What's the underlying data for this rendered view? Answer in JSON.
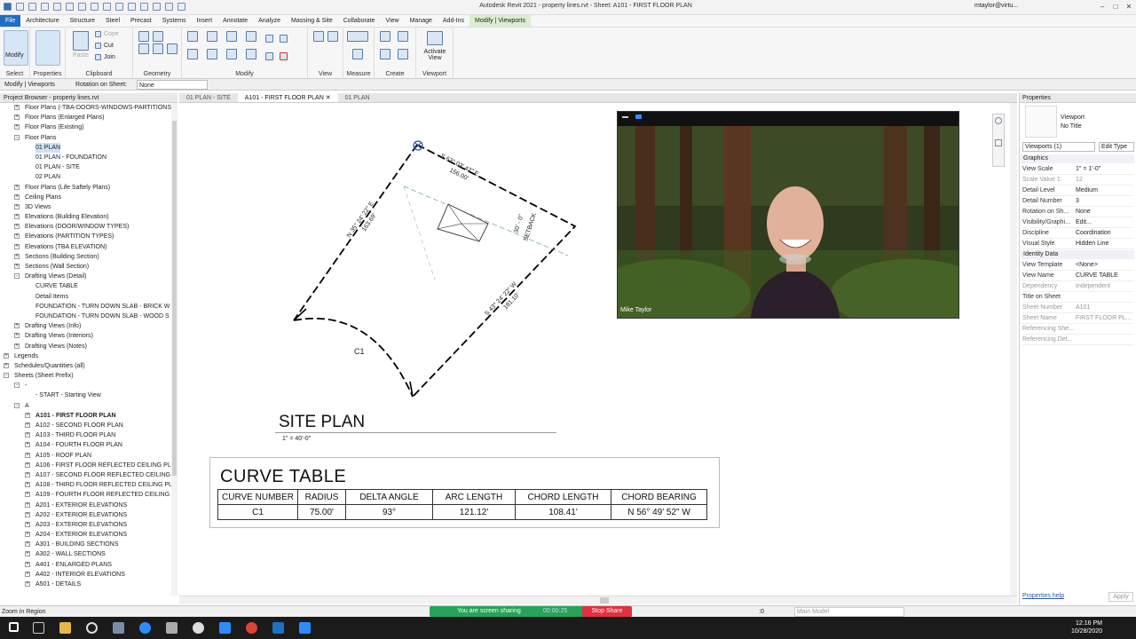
{
  "app": {
    "title": "Autodesk Revit 2021 - property lines.rvt - Sheet: A101 - FIRST FLOOR PLAN",
    "user": "mtaylor@virtu...",
    "menu_tabs": [
      "File",
      "Architecture",
      "Structure",
      "Steel",
      "Precast",
      "Systems",
      "Insert",
      "Annotate",
      "Analyze",
      "Massing & Site",
      "Collaborate",
      "View",
      "Manage",
      "Add-Ins",
      "Modify | Viewports"
    ]
  },
  "ribbon": {
    "groups": [
      "Select",
      "Properties",
      "Clipboard",
      "Geometry",
      "Modify",
      "View",
      "Measure",
      "Create",
      "Viewport"
    ],
    "modify_label": "Modify",
    "clipboard_items": [
      "Paste",
      "Cope",
      "Cut",
      "Join"
    ],
    "activate_view": "Activate View"
  },
  "options_bar": {
    "context": "Modify | Viewports",
    "rotation_label": "Rotation on Sheet:",
    "rotation_value": "None"
  },
  "project_browser": {
    "header": "Project Browser - property lines.rvt",
    "items": [
      {
        "label": "Floor Plans (-TBA-DOORS-WINDOWS-PARTITIONS",
        "level": 1,
        "tw": "+"
      },
      {
        "label": "Floor Plans (Enlarged Plans)",
        "level": 1,
        "tw": "+"
      },
      {
        "label": "Floor Plans (Existing)",
        "level": 1,
        "tw": "+"
      },
      {
        "label": "Floor Plans",
        "level": 1,
        "tw": "-"
      },
      {
        "label": "01 PLAN",
        "level": 2,
        "tw": "",
        "sel": true
      },
      {
        "label": "01 PLAN - FOUNDATION",
        "level": 2,
        "tw": ""
      },
      {
        "label": "01 PLAN - SITE",
        "level": 2,
        "tw": ""
      },
      {
        "label": "02 PLAN",
        "level": 2,
        "tw": ""
      },
      {
        "label": "Floor Plans (Life Saftely Plans)",
        "level": 1,
        "tw": "+"
      },
      {
        "label": "Ceiling Plans",
        "level": 1,
        "tw": "+"
      },
      {
        "label": "3D Views",
        "level": 1,
        "tw": "+"
      },
      {
        "label": "Elevations (Building Elevation)",
        "level": 1,
        "tw": "+"
      },
      {
        "label": "Elevations (DOOR/WINDOW TYPES)",
        "level": 1,
        "tw": "+"
      },
      {
        "label": "Elevations (PARTITION TYPES)",
        "level": 1,
        "tw": "+"
      },
      {
        "label": "Elevations (TBA ELEVATION)",
        "level": 1,
        "tw": "+"
      },
      {
        "label": "Sections (Building Section)",
        "level": 1,
        "tw": "+"
      },
      {
        "label": "Sections (Wall Section)",
        "level": 1,
        "tw": "+"
      },
      {
        "label": "Drafting Views (Detail)",
        "level": 1,
        "tw": "-"
      },
      {
        "label": "CURVE TABLE",
        "level": 2,
        "tw": ""
      },
      {
        "label": "Detail Items",
        "level": 2,
        "tw": ""
      },
      {
        "label": "FOUNDATION - TURN DOWN SLAB - BRICK W",
        "level": 2,
        "tw": ""
      },
      {
        "label": "FOUNDATION - TURN DOWN SLAB - WOOD S",
        "level": 2,
        "tw": ""
      },
      {
        "label": "Drafting Views (Info)",
        "level": 1,
        "tw": "+"
      },
      {
        "label": "Drafting Views (Interiors)",
        "level": 1,
        "tw": "+"
      },
      {
        "label": "Drafting Views (Notes)",
        "level": 1,
        "tw": "+"
      },
      {
        "label": "Legends",
        "level": 0,
        "tw": "+"
      },
      {
        "label": "Schedules/Quantities (all)",
        "level": 0,
        "tw": "+"
      },
      {
        "label": "Sheets (Sheet Prefix)",
        "level": 0,
        "tw": "-"
      },
      {
        "label": "-",
        "level": 1,
        "tw": "-"
      },
      {
        "label": "- START - Starting View",
        "level": 2,
        "tw": ""
      },
      {
        "label": "A",
        "level": 1,
        "tw": "-"
      },
      {
        "label": "A101 - FIRST FLOOR PLAN",
        "level": 2,
        "tw": "+",
        "bold": true
      },
      {
        "label": "A102 - SECOND FLOOR PLAN",
        "level": 2,
        "tw": "+"
      },
      {
        "label": "A103 - THIRD FLOOR PLAN",
        "level": 2,
        "tw": "+"
      },
      {
        "label": "A104 - FOURTH FLOOR PLAN",
        "level": 2,
        "tw": "+"
      },
      {
        "label": "A105 - ROOF PLAN",
        "level": 2,
        "tw": "+"
      },
      {
        "label": "A106 - FIRST FLOOR REFLECTED CEILING PLAN",
        "level": 2,
        "tw": "+"
      },
      {
        "label": "A107 - SECOND FLOOR REFLECTED CEILING PL",
        "level": 2,
        "tw": "+"
      },
      {
        "label": "A108 - THIRD FLOOR REFLECTED CEILING PLA",
        "level": 2,
        "tw": "+"
      },
      {
        "label": "A109 - FOURTH FLOOR REFLECTED CEILING PL",
        "level": 2,
        "tw": "+"
      },
      {
        "label": "A201 - EXTERIOR ELEVATIONS",
        "level": 2,
        "tw": "+"
      },
      {
        "label": "A202 - EXTERIOR ELEVATIONS",
        "level": 2,
        "tw": "+"
      },
      {
        "label": "A203 - EXTERIOR ELEVATIONS",
        "level": 2,
        "tw": "+"
      },
      {
        "label": "A204 - EXTERIOR ELEVATIONS",
        "level": 2,
        "tw": "+"
      },
      {
        "label": "A301 - BUILDING SECTIONS",
        "level": 2,
        "tw": "+"
      },
      {
        "label": "A302 - WALL SECTIONS",
        "level": 2,
        "tw": "+"
      },
      {
        "label": "A401 - ENLARGED PLANS",
        "level": 2,
        "tw": "+"
      },
      {
        "label": "A402 - INTERIOR ELEVATIONS",
        "level": 2,
        "tw": "+"
      },
      {
        "label": "A501 - DETAILS",
        "level": 2,
        "tw": "+"
      }
    ]
  },
  "view_tabs": [
    {
      "label": "01 PLAN - SITE",
      "active": false
    },
    {
      "label": "A101 - FIRST FLOOR PLAN",
      "active": true
    },
    {
      "label": "01 PLAN",
      "active": false
    }
  ],
  "drawing": {
    "bearing_top": "S 63° 03' 42\" E",
    "dist_top": "156.00'",
    "bearing_left": "N 35° 24' 22\" E",
    "dist_left": "163.69'",
    "bearing_right": "S 43° 24' 22\" W",
    "dist_right": "181.10'",
    "setback_dist": "30' - 0\"",
    "setback_label": "SETBACK",
    "curve_label": "C1",
    "site_title": "SITE PLAN",
    "site_scale": "1\" = 40'-0\""
  },
  "curve_table": {
    "title": "CURVE TABLE",
    "headers": [
      "CURVE NUMBER",
      "RADIUS",
      "DELTA ANGLE",
      "ARC LENGTH",
      "CHORD LENGTH",
      "CHORD BEARING"
    ],
    "row": [
      "C1",
      "75.00'",
      "93°",
      "121.12'",
      "108.41'",
      "N 56° 49' 52\" W"
    ]
  },
  "zoom": {
    "participant": "Mike Taylor",
    "sharing_text": "You are screen sharing",
    "timer": "00:00:25",
    "stop_label": "Stop Share"
  },
  "properties": {
    "header": "Properties",
    "type_family": "Viewport",
    "type_name": "No Title",
    "selector": "Viewports (1)",
    "edit_type": "Edit Type",
    "sections": {
      "graphics": "Graphics",
      "identity": "Identity Data"
    },
    "rows": [
      {
        "k": "View Scale",
        "v": "1\" = 1'-0\""
      },
      {
        "k": "Scale Value   1:",
        "v": "12",
        "gray": true
      },
      {
        "k": "Detail Level",
        "v": "Medium"
      },
      {
        "k": "Detail Number",
        "v": "3"
      },
      {
        "k": "Rotation on Sh...",
        "v": "None"
      },
      {
        "k": "Visibility/Graphi...",
        "v": "Edit..."
      },
      {
        "k": "Discipline",
        "v": "Coordination"
      },
      {
        "k": "Visual Style",
        "v": "Hidden Line"
      },
      {
        "k": "View Template",
        "v": "<None>"
      },
      {
        "k": "View Name",
        "v": "CURVE TABLE"
      },
      {
        "k": "Dependency",
        "v": "Independent",
        "gray": true
      },
      {
        "k": "Title on Sheet",
        "v": ""
      },
      {
        "k": "Sheet Number",
        "v": "A101",
        "gray": true
      },
      {
        "k": "Sheet Name",
        "v": "FIRST FLOOR PL...",
        "gray": true
      },
      {
        "k": "Referencing She...",
        "v": "",
        "gray": true
      },
      {
        "k": "Referencing Det...",
        "v": "",
        "gray": true
      }
    ],
    "help": "Properties help",
    "apply": "Apply"
  },
  "status": {
    "left": "Zoom in Region",
    "scale_value": ":0",
    "model": "Main Model"
  },
  "clock": {
    "time": "12:16 PM",
    "date": "10/28/2020"
  },
  "colors": {
    "file_tab": "#1f6fc4",
    "ctx_tab": "#dcedd0",
    "share_green": "#27a35a",
    "stop_red": "#e0313c"
  }
}
